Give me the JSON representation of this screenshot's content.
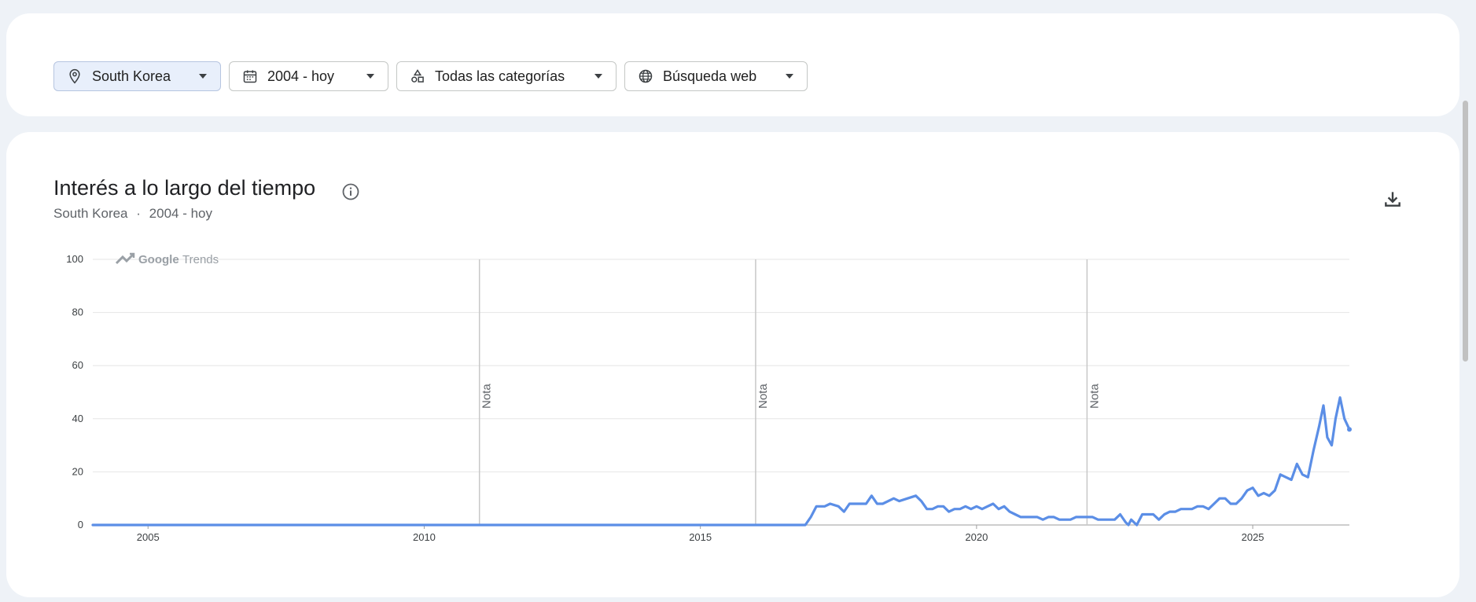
{
  "filters": {
    "location": "South Korea",
    "period": "2004 - hoy",
    "category": "Todas las categorías",
    "search_type": "Búsqueda web"
  },
  "icons": {
    "location": "location-pin-icon",
    "period": "calendar-icon",
    "category": "category-shapes-icon",
    "search_type": "globe-icon",
    "caret": "caret-down-icon",
    "info": "info-icon",
    "download": "download-icon",
    "trends_logo": "trending-arrow-icon"
  },
  "chart_header": {
    "title": "Interés a lo largo del tiempo",
    "subtitle_location": "South Korea",
    "subtitle_separator": "·",
    "subtitle_period": "2004 - hoy"
  },
  "colors": {
    "line": "#5b8ee6",
    "grid": "#e6e6e6",
    "note_line": "#c8c8c8",
    "chip_active_bg": "#e8effb"
  },
  "chart_data": {
    "type": "line",
    "watermark_bold": "Google",
    "watermark_rest": "Trends",
    "ylim": [
      0,
      100
    ],
    "yticks": [
      0,
      20,
      40,
      60,
      80,
      100
    ],
    "xlim": [
      2004.0,
      2026.75
    ],
    "xticks": [
      {
        "value": 2005,
        "label": "2005"
      },
      {
        "value": 2010,
        "label": "2010"
      },
      {
        "value": 2015,
        "label": "2015"
      },
      {
        "value": 2020,
        "label": "2020"
      },
      {
        "value": 2025,
        "label": "2025"
      }
    ],
    "notes": [
      {
        "x": 2011.0,
        "label": "Nota"
      },
      {
        "x": 2016.0,
        "label": "Nota"
      },
      {
        "x": 2022.0,
        "label": "Nota"
      }
    ],
    "series": [
      {
        "points": [
          [
            2004.0,
            0
          ],
          [
            2016.9,
            0
          ],
          [
            2017.0,
            3
          ],
          [
            2017.1,
            7
          ],
          [
            2017.25,
            7
          ],
          [
            2017.35,
            8
          ],
          [
            2017.5,
            7
          ],
          [
            2017.6,
            5
          ],
          [
            2017.7,
            8
          ],
          [
            2017.85,
            8
          ],
          [
            2018.0,
            8
          ],
          [
            2018.1,
            11
          ],
          [
            2018.2,
            8
          ],
          [
            2018.3,
            8
          ],
          [
            2018.5,
            10
          ],
          [
            2018.6,
            9
          ],
          [
            2018.75,
            10
          ],
          [
            2018.9,
            11
          ],
          [
            2019.0,
            9
          ],
          [
            2019.1,
            6
          ],
          [
            2019.2,
            6
          ],
          [
            2019.3,
            7
          ],
          [
            2019.4,
            7
          ],
          [
            2019.5,
            5
          ],
          [
            2019.6,
            6
          ],
          [
            2019.7,
            6
          ],
          [
            2019.8,
            7
          ],
          [
            2019.9,
            6
          ],
          [
            2020.0,
            7
          ],
          [
            2020.1,
            6
          ],
          [
            2020.2,
            7
          ],
          [
            2020.3,
            8
          ],
          [
            2020.4,
            6
          ],
          [
            2020.5,
            7
          ],
          [
            2020.6,
            5
          ],
          [
            2020.7,
            4
          ],
          [
            2020.8,
            3
          ],
          [
            2020.9,
            3
          ],
          [
            2021.0,
            3
          ],
          [
            2021.1,
            3
          ],
          [
            2021.2,
            2
          ],
          [
            2021.3,
            3
          ],
          [
            2021.4,
            3
          ],
          [
            2021.5,
            2
          ],
          [
            2021.6,
            2
          ],
          [
            2021.7,
            2
          ],
          [
            2021.8,
            3
          ],
          [
            2021.9,
            3
          ],
          [
            2022.0,
            3
          ],
          [
            2022.1,
            3
          ],
          [
            2022.2,
            2
          ],
          [
            2022.3,
            2
          ],
          [
            2022.4,
            2
          ],
          [
            2022.5,
            2
          ],
          [
            2022.6,
            4
          ],
          [
            2022.7,
            1
          ],
          [
            2022.75,
            0
          ],
          [
            2022.8,
            2
          ],
          [
            2022.9,
            0
          ],
          [
            2023.0,
            4
          ],
          [
            2023.1,
            4
          ],
          [
            2023.2,
            4
          ],
          [
            2023.3,
            2
          ],
          [
            2023.4,
            4
          ],
          [
            2023.5,
            5
          ],
          [
            2023.6,
            5
          ],
          [
            2023.7,
            6
          ],
          [
            2023.8,
            6
          ],
          [
            2023.9,
            6
          ],
          [
            2024.0,
            7
          ],
          [
            2024.1,
            7
          ],
          [
            2024.2,
            6
          ],
          [
            2024.3,
            8
          ],
          [
            2024.4,
            10
          ],
          [
            2024.5,
            10
          ],
          [
            2024.6,
            8
          ],
          [
            2024.7,
            8
          ],
          [
            2024.8,
            10
          ],
          [
            2024.9,
            13
          ],
          [
            2025.0,
            14
          ],
          [
            2025.1,
            11
          ],
          [
            2025.2,
            12
          ],
          [
            2025.3,
            11
          ],
          [
            2025.4,
            13
          ],
          [
            2025.5,
            19
          ],
          [
            2025.6,
            18
          ],
          [
            2025.7,
            17
          ],
          [
            2025.8,
            23
          ],
          [
            2025.9,
            19
          ],
          [
            2026.0,
            18
          ],
          [
            2026.1,
            28
          ],
          [
            2026.2,
            37
          ],
          [
            2026.28,
            45
          ],
          [
            2026.35,
            33
          ],
          [
            2026.43,
            30
          ],
          [
            2026.5,
            40
          ],
          [
            2026.58,
            48
          ],
          [
            2026.66,
            40
          ],
          [
            2026.75,
            36
          ]
        ]
      }
    ]
  }
}
